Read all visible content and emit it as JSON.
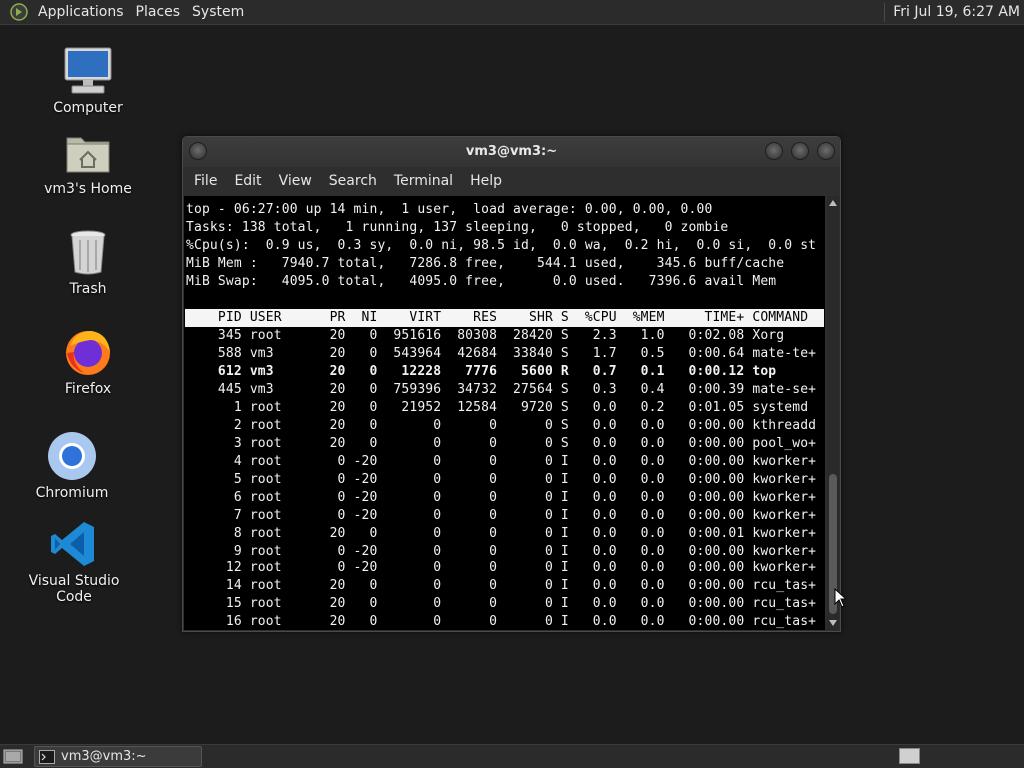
{
  "top_panel": {
    "menus": [
      "Applications",
      "Places",
      "System"
    ],
    "clock": "Fri Jul 19,  6:27 AM"
  },
  "desktop_icons": [
    {
      "label": "Computer",
      "icon": "computer-icon"
    },
    {
      "label": "vm3's Home",
      "icon": "home-folder-icon"
    },
    {
      "label": "Trash",
      "icon": "trash-icon"
    },
    {
      "label": "Firefox",
      "icon": "firefox-icon"
    },
    {
      "label": "Chromium",
      "icon": "chromium-icon"
    },
    {
      "label": "Visual Studio Code",
      "icon": "vscode-icon"
    }
  ],
  "terminal": {
    "title": "vm3@vm3:~",
    "menu": [
      "File",
      "Edit",
      "View",
      "Search",
      "Terminal",
      "Help"
    ],
    "summary_lines": [
      "top - 06:27:00 up 14 min,  1 user,  load average: 0.00, 0.00, 0.00",
      "Tasks: 138 total,   1 running, 137 sleeping,   0 stopped,   0 zombie",
      "%Cpu(s):  0.9 us,  0.3 sy,  0.0 ni, 98.5 id,  0.0 wa,  0.2 hi,  0.0 si,  0.0 st",
      "MiB Mem :   7940.7 total,   7286.8 free,    544.1 used,    345.6 buff/cache",
      "MiB Swap:   4095.0 total,   4095.0 free,      0.0 used.   7396.6 avail Mem"
    ],
    "process_header": "    PID USER      PR  NI    VIRT    RES    SHR S  %CPU  %MEM     TIME+ COMMAND",
    "process_rows": [
      {
        "text": "    345 root      20   0  951616  80308  28420 S   2.3   1.0   0:02.08 Xorg",
        "bold": false
      },
      {
        "text": "    588 vm3       20   0  543964  42684  33840 S   1.7   0.5   0:00.64 mate-te+",
        "bold": false
      },
      {
        "text": "    612 vm3       20   0   12228   7776   5600 R   0.7   0.1   0:00.12 top",
        "bold": true
      },
      {
        "text": "    445 vm3       20   0  759396  34732  27564 S   0.3   0.4   0:00.39 mate-se+",
        "bold": false
      },
      {
        "text": "      1 root      20   0   21952  12584   9720 S   0.0   0.2   0:01.05 systemd",
        "bold": false
      },
      {
        "text": "      2 root      20   0       0      0      0 S   0.0   0.0   0:00.00 kthreadd",
        "bold": false
      },
      {
        "text": "      3 root      20   0       0      0      0 S   0.0   0.0   0:00.00 pool_wo+",
        "bold": false
      },
      {
        "text": "      4 root       0 -20       0      0      0 I   0.0   0.0   0:00.00 kworker+",
        "bold": false
      },
      {
        "text": "      5 root       0 -20       0      0      0 I   0.0   0.0   0:00.00 kworker+",
        "bold": false
      },
      {
        "text": "      6 root       0 -20       0      0      0 I   0.0   0.0   0:00.00 kworker+",
        "bold": false
      },
      {
        "text": "      7 root       0 -20       0      0      0 I   0.0   0.0   0:00.00 kworker+",
        "bold": false
      },
      {
        "text": "      8 root      20   0       0      0      0 I   0.0   0.0   0:00.01 kworker+",
        "bold": false
      },
      {
        "text": "      9 root       0 -20       0      0      0 I   0.0   0.0   0:00.00 kworker+",
        "bold": false
      },
      {
        "text": "     12 root       0 -20       0      0      0 I   0.0   0.0   0:00.00 kworker+",
        "bold": false
      },
      {
        "text": "     14 root      20   0       0      0      0 I   0.0   0.0   0:00.00 rcu_tas+",
        "bold": false
      },
      {
        "text": "     15 root      20   0       0      0      0 I   0.0   0.0   0:00.00 rcu_tas+",
        "bold": false
      },
      {
        "text": "     16 root      20   0       0      0      0 I   0.0   0.0   0:00.00 rcu_tas+",
        "bold": false
      }
    ]
  },
  "taskbar": {
    "task_label": "vm3@vm3:~"
  }
}
